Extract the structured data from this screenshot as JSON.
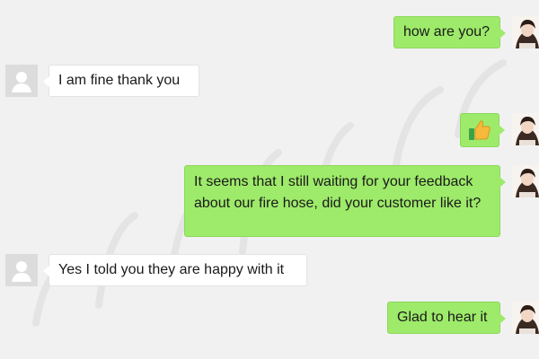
{
  "colors": {
    "outgoing_bubble": "#9eea6a",
    "incoming_bubble": "#ffffff",
    "background": "#f1f1f1"
  },
  "messages": [
    {
      "direction": "outgoing",
      "text": "how are you?",
      "avatar": "user-avatar"
    },
    {
      "direction": "incoming",
      "text": "I am fine thank you",
      "avatar": "default-avatar"
    },
    {
      "direction": "outgoing",
      "emoji": "thumbs-up-icon",
      "avatar": "user-avatar"
    },
    {
      "direction": "outgoing",
      "text": "It seems that I still waiting for your feedback about our fire hose, did your customer like it?",
      "avatar": "user-avatar"
    },
    {
      "direction": "incoming",
      "text": "Yes I told you they are happy with it",
      "avatar": "default-avatar"
    },
    {
      "direction": "outgoing",
      "text": "Glad to hear it",
      "avatar": "user-avatar"
    }
  ]
}
